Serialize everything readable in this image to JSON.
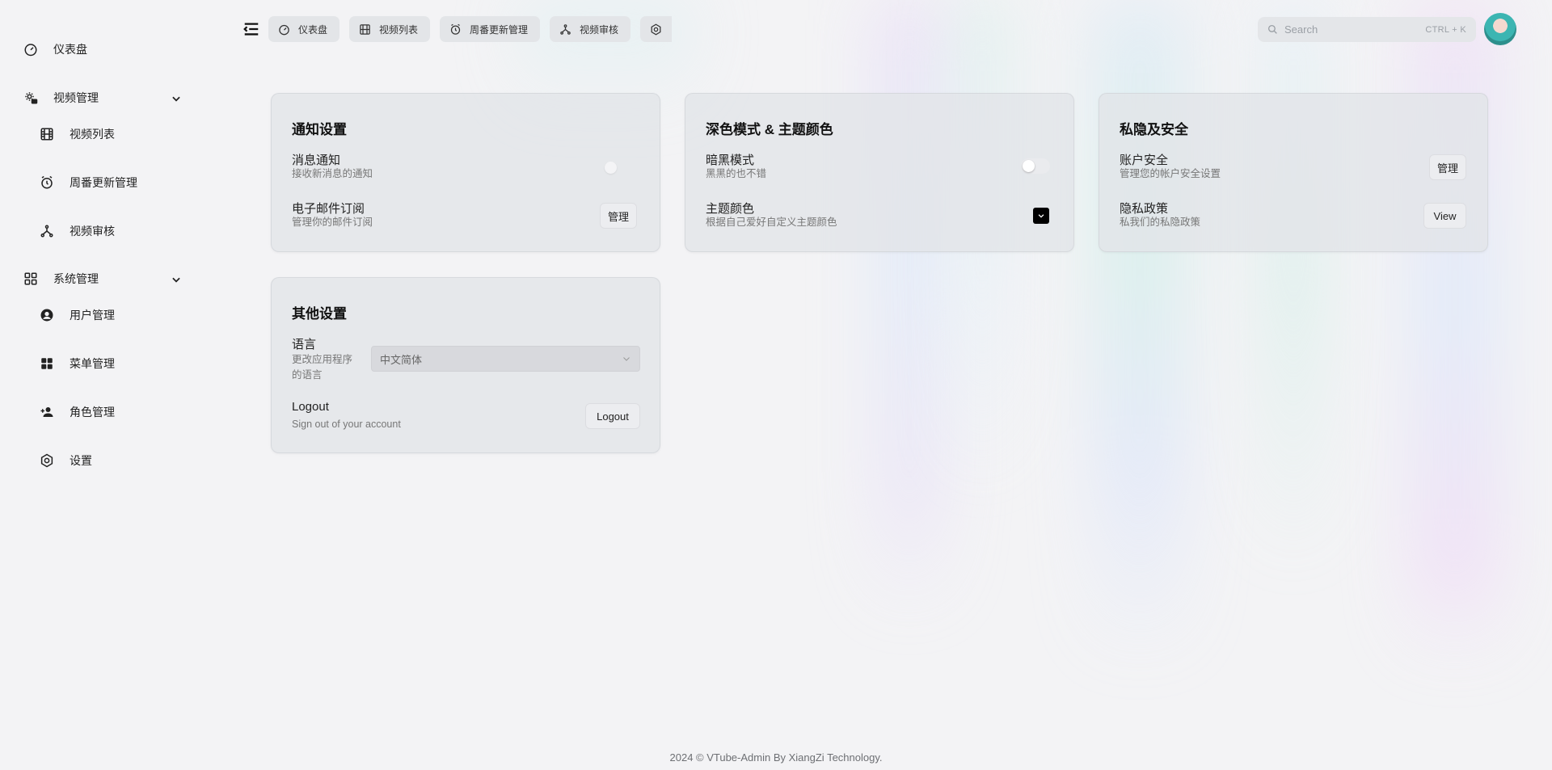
{
  "sidebar": {
    "dashboard": "仪表盘",
    "video_group": "视频管理",
    "video_list": "视频列表",
    "weekly_update": "周番更新管理",
    "video_review": "视频审核",
    "system_group": "系统管理",
    "user_manage": "用户管理",
    "menu_manage": "菜单管理",
    "role_manage": "角色管理",
    "settings": "设置"
  },
  "tabs": [
    {
      "label": "仪表盘",
      "icon": "gauge-icon"
    },
    {
      "label": "视频列表",
      "icon": "film-icon"
    },
    {
      "label": "周番更新管理",
      "icon": "alarm-clock-icon"
    },
    {
      "label": "视频审核",
      "icon": "branch-icon"
    },
    {
      "label": "",
      "icon": "settings-icon"
    }
  ],
  "search": {
    "placeholder": "Search",
    "shortcut": "CTRL + K"
  },
  "cards": {
    "notify": {
      "title": "通知设置",
      "msg_title": "消息通知",
      "msg_sub": "接收新消息的通知",
      "email_title": "电子邮件订阅",
      "email_sub": "管理你的邮件订阅",
      "email_btn": "管理"
    },
    "theme": {
      "title": "深色模式 & 主题颜色",
      "dark_title": "暗黑模式",
      "dark_sub": "黑黑的也不错",
      "color_title": "主题颜色",
      "color_sub": "根据自己爱好自定义主题颜色"
    },
    "privacy": {
      "title": "私隐及安全",
      "account_title": "账户安全",
      "account_sub": "管理您的帐户安全设置",
      "account_btn": "管理",
      "policy_title": "隐私政策",
      "policy_sub": "私我们的私隐政策",
      "policy_btn": "View"
    },
    "other": {
      "title": "其他设置",
      "lang_title": "语言",
      "lang_sub_1": "更改应用程序",
      "lang_sub_2": "的语言",
      "lang_value": "中文简体",
      "logout_title": "Logout",
      "logout_sub": "Sign out of your account",
      "logout_btn": "Logout"
    }
  },
  "footer": "2024 © VTube-Admin By XiangZi Technology."
}
